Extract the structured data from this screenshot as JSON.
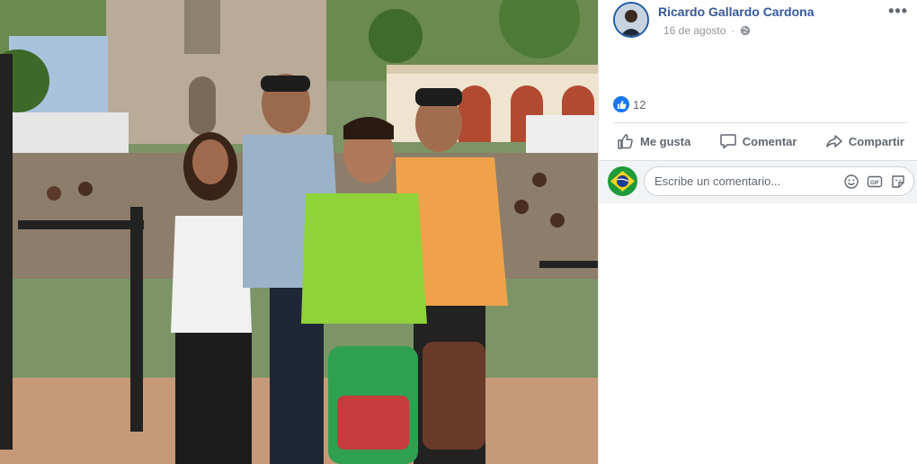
{
  "post": {
    "author": "Ricardo Gallardo Cardona",
    "date": "16 de agosto",
    "privacy_icon": "globe-icon",
    "more_label": "•••"
  },
  "reactions": {
    "count": "12",
    "icon": "like-icon"
  },
  "actions": {
    "like": "Me gusta",
    "comment": "Comentar",
    "share": "Compartir"
  },
  "comment": {
    "placeholder": "Escribe un comentario..."
  },
  "colors": {
    "link": "#365899",
    "like_blue": "#1877f2",
    "comment_bg": "#f2f3f5"
  }
}
